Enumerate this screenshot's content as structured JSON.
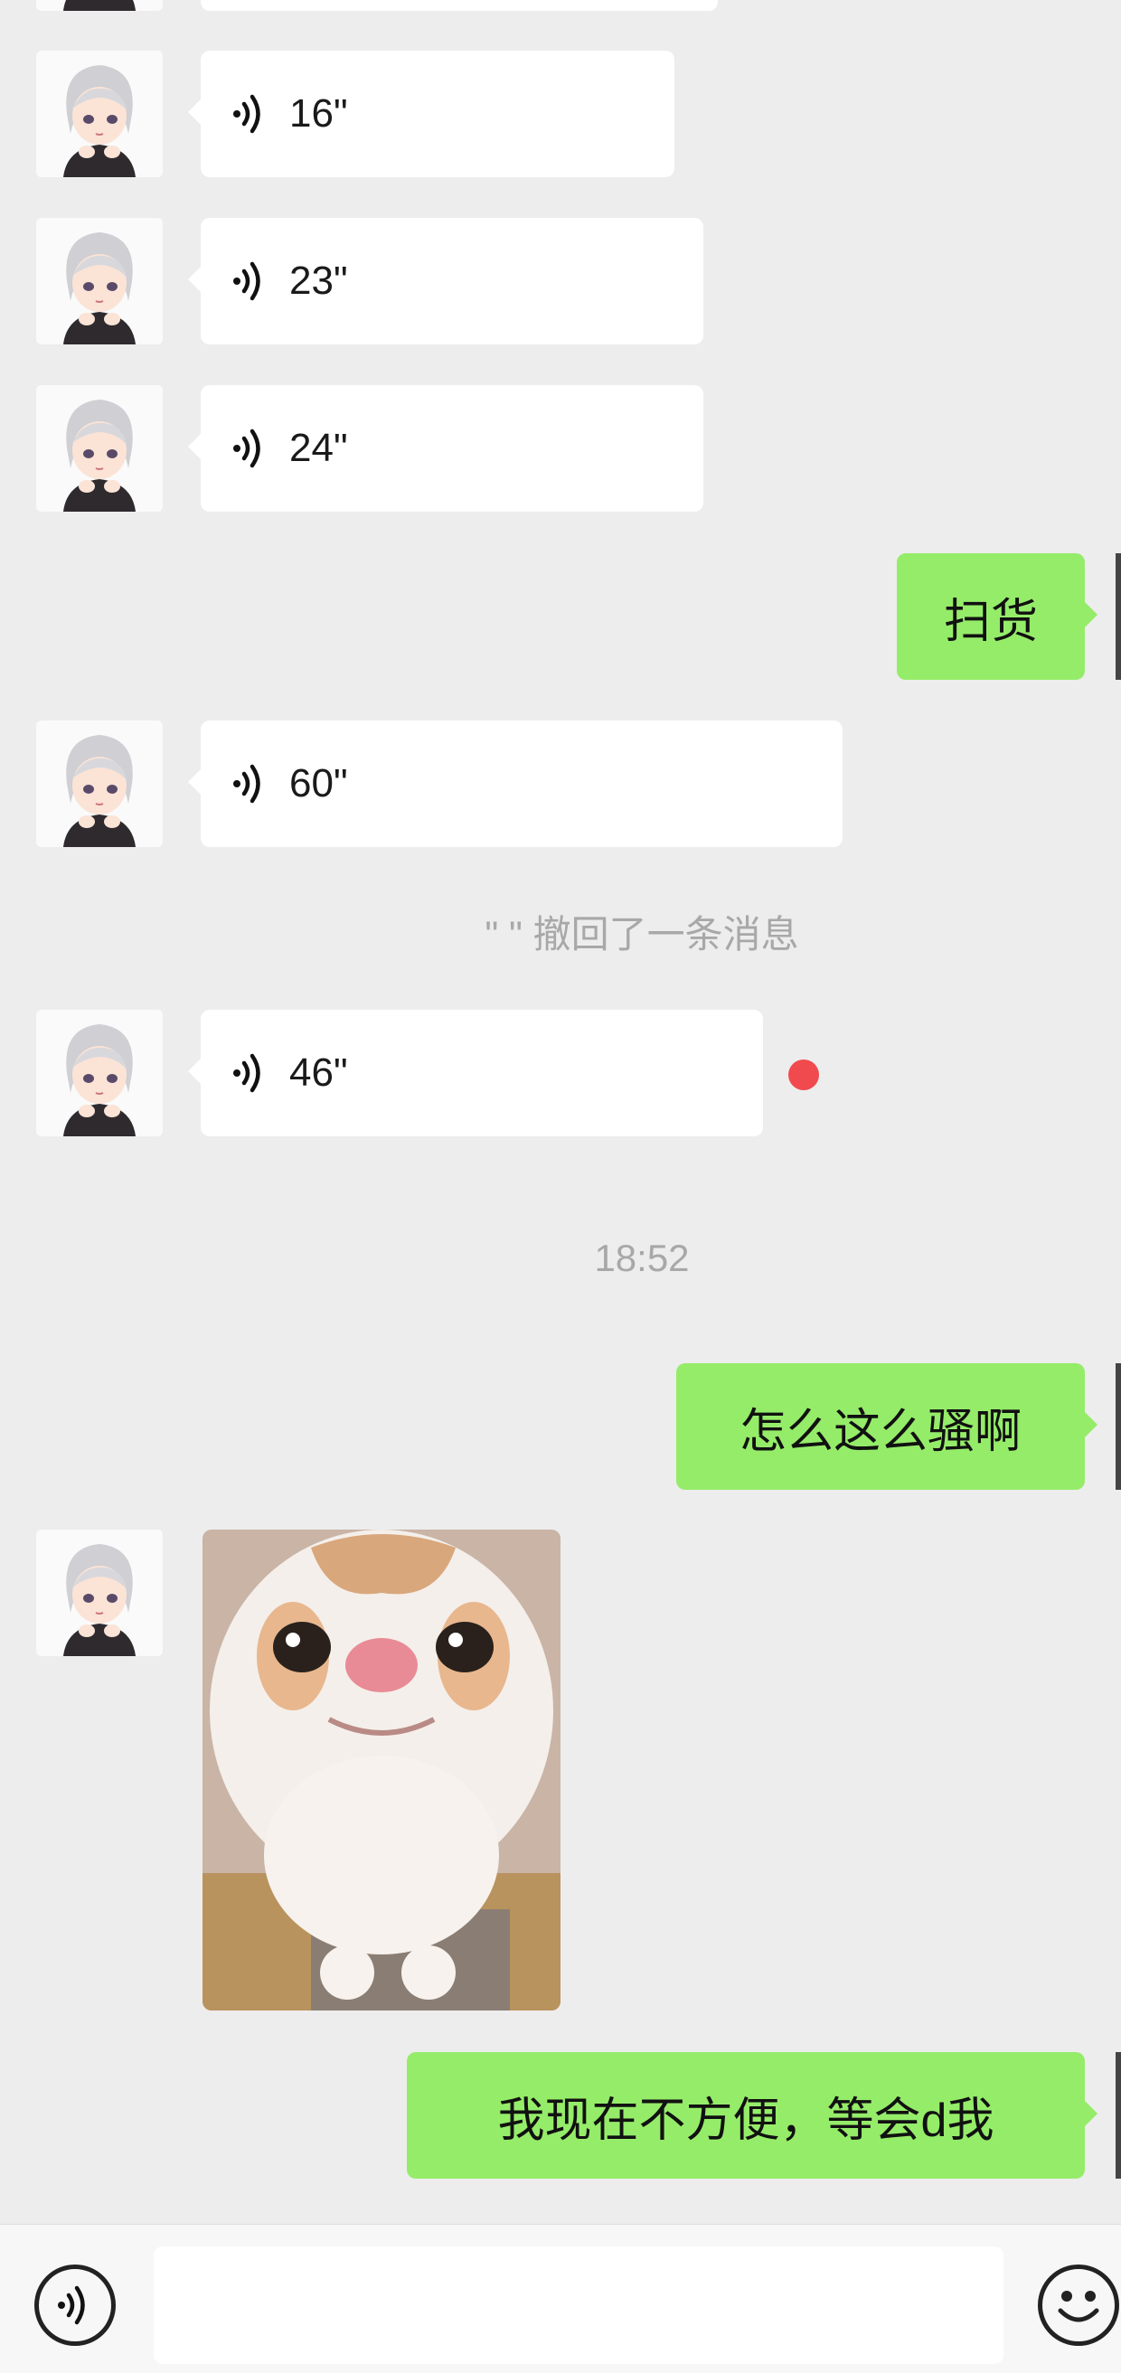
{
  "messages": {
    "voice_1": {
      "duration": "16\""
    },
    "voice_2": {
      "duration": "23\""
    },
    "voice_3": {
      "duration": "24\""
    },
    "sent_1": {
      "text": "扫货"
    },
    "voice_4": {
      "duration": "60\""
    },
    "recall_notice": "\" \" 撤回了一条消息",
    "voice_5": {
      "duration": "46\"",
      "unread": true
    },
    "timestamp": "18:52",
    "sent_2": {
      "text": "怎么这么骚啊"
    },
    "sticker": {
      "icon": "cat-sticker-image"
    },
    "sent_3": {
      "text": "我现在不方便，等会d我"
    }
  },
  "input_bar": {
    "voice_button_icon": "voice-mode-icon",
    "emoji_button_icon": "emoji-icon",
    "text_value": ""
  },
  "colors": {
    "background": "#ededed",
    "sent_bubble": "#95ec69",
    "received_bubble": "#ffffff",
    "unread_dot": "#f04a4f",
    "system_text": "#a8a8a8"
  }
}
